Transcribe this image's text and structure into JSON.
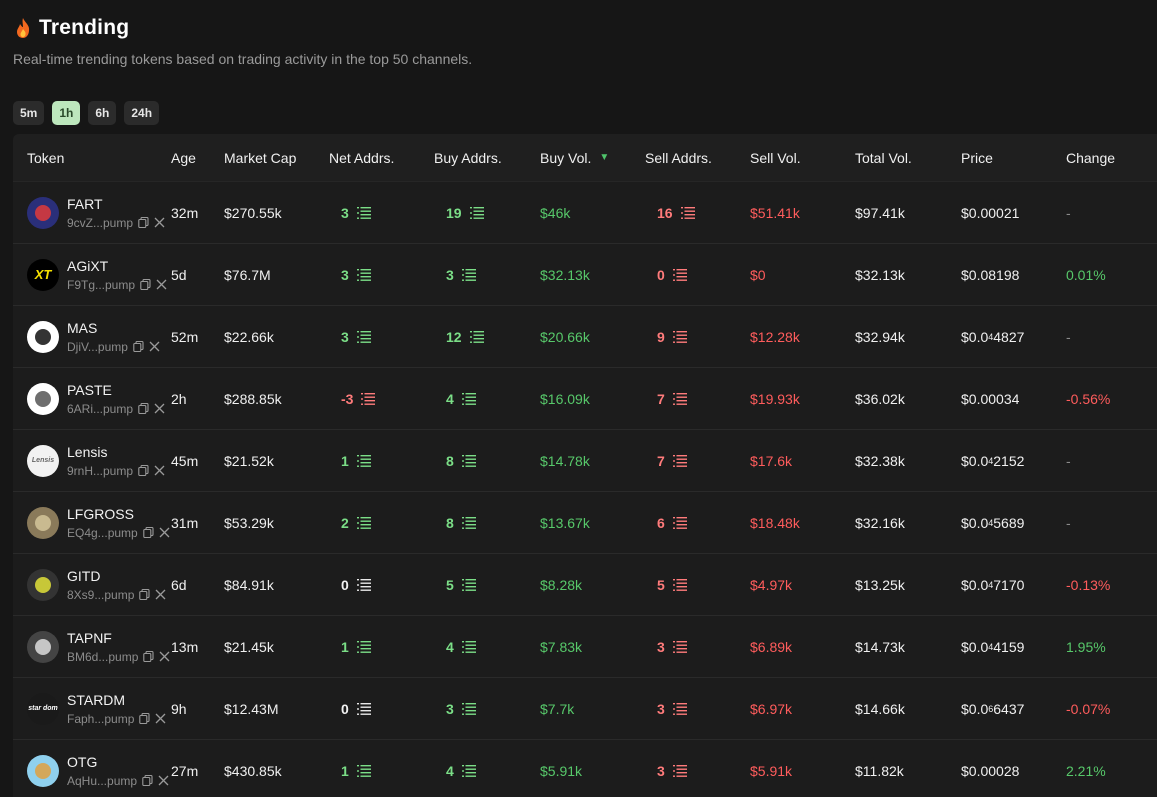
{
  "header": {
    "title": "Trending",
    "subtitle": "Real-time trending tokens based on trading activity in the top 50 channels."
  },
  "timeframes": [
    {
      "label": "5m",
      "active": false
    },
    {
      "label": "1h",
      "active": true
    },
    {
      "label": "6h",
      "active": false
    },
    {
      "label": "24h",
      "active": false
    }
  ],
  "columns": {
    "token": "Token",
    "age": "Age",
    "market_cap": "Market Cap",
    "net_addrs": "Net Addrs.",
    "buy_addrs": "Buy Addrs.",
    "buy_vol": "Buy Vol.",
    "sell_addrs": "Sell Addrs.",
    "sell_vol": "Sell Vol.",
    "total_vol": "Total Vol.",
    "price": "Price",
    "change": "Change"
  },
  "rows": [
    {
      "name": "FART",
      "addr": "9cvZ...pump",
      "age": "32m",
      "market_cap": "$270.55k",
      "net": "3",
      "net_sign": "pos",
      "buy": "19",
      "buy_vol": "$46k",
      "sell": "16",
      "sell_vol": "$51.41k",
      "total_vol": "$97.41k",
      "price_main": "$0.00021",
      "price_sub": "",
      "price_tail": "",
      "change": "-",
      "change_sign": "none"
    },
    {
      "name": "AGiXT",
      "addr": "F9Tg...pump",
      "age": "5d",
      "market_cap": "$76.7M",
      "net": "3",
      "net_sign": "pos",
      "buy": "3",
      "buy_vol": "$32.13k",
      "sell": "0",
      "sell_vol": "$0",
      "total_vol": "$32.13k",
      "price_main": "$0.08198",
      "price_sub": "",
      "price_tail": "",
      "change": "0.01%",
      "change_sign": "pos"
    },
    {
      "name": "MAS",
      "addr": "DjiV...pump",
      "age": "52m",
      "market_cap": "$22.66k",
      "net": "3",
      "net_sign": "pos",
      "buy": "12",
      "buy_vol": "$20.66k",
      "sell": "9",
      "sell_vol": "$12.28k",
      "total_vol": "$32.94k",
      "price_main": "$0.0",
      "price_sub": "4",
      "price_tail": "4827",
      "change": "-",
      "change_sign": "none"
    },
    {
      "name": "PASTE",
      "addr": "6ARi...pump",
      "age": "2h",
      "market_cap": "$288.85k",
      "net": "-3",
      "net_sign": "neg",
      "buy": "4",
      "buy_vol": "$16.09k",
      "sell": "7",
      "sell_vol": "$19.93k",
      "total_vol": "$36.02k",
      "price_main": "$0.00034",
      "price_sub": "",
      "price_tail": "",
      "change": "-0.56%",
      "change_sign": "neg"
    },
    {
      "name": "Lensis",
      "addr": "9rnH...pump",
      "age": "45m",
      "market_cap": "$21.52k",
      "net": "1",
      "net_sign": "pos",
      "buy": "8",
      "buy_vol": "$14.78k",
      "sell": "7",
      "sell_vol": "$17.6k",
      "total_vol": "$32.38k",
      "price_main": "$0.0",
      "price_sub": "4",
      "price_tail": "2152",
      "change": "-",
      "change_sign": "none"
    },
    {
      "name": "LFGROSS",
      "addr": "EQ4g...pump",
      "age": "31m",
      "market_cap": "$53.29k",
      "net": "2",
      "net_sign": "pos",
      "buy": "8",
      "buy_vol": "$13.67k",
      "sell": "6",
      "sell_vol": "$18.48k",
      "total_vol": "$32.16k",
      "price_main": "$0.0",
      "price_sub": "4",
      "price_tail": "5689",
      "change": "-",
      "change_sign": "none"
    },
    {
      "name": "GITD",
      "addr": "8Xs9...pump",
      "age": "6d",
      "market_cap": "$84.91k",
      "net": "0",
      "net_sign": "zero",
      "buy": "5",
      "buy_vol": "$8.28k",
      "sell": "5",
      "sell_vol": "$4.97k",
      "total_vol": "$13.25k",
      "price_main": "$0.0",
      "price_sub": "4",
      "price_tail": "7170",
      "change": "-0.13%",
      "change_sign": "neg"
    },
    {
      "name": "TAPNF",
      "addr": "BM6d...pump",
      "age": "13m",
      "market_cap": "$21.45k",
      "net": "1",
      "net_sign": "pos",
      "buy": "4",
      "buy_vol": "$7.83k",
      "sell": "3",
      "sell_vol": "$6.89k",
      "total_vol": "$14.73k",
      "price_main": "$0.0",
      "price_sub": "4",
      "price_tail": "4159",
      "change": "1.95%",
      "change_sign": "pos"
    },
    {
      "name": "STARDM",
      "addr": "Faph...pump",
      "age": "9h",
      "market_cap": "$12.43M",
      "net": "0",
      "net_sign": "zero",
      "buy": "3",
      "buy_vol": "$7.7k",
      "sell": "3",
      "sell_vol": "$6.97k",
      "total_vol": "$14.66k",
      "price_main": "$0.0",
      "price_sub": "6",
      "price_tail": "6437",
      "change": "-0.07%",
      "change_sign": "neg"
    },
    {
      "name": "OTG",
      "addr": "AqHu...pump",
      "age": "27m",
      "market_cap": "$430.85k",
      "net": "1",
      "net_sign": "pos",
      "buy": "4",
      "buy_vol": "$5.91k",
      "sell": "3",
      "sell_vol": "$5.91k",
      "total_vol": "$11.82k",
      "price_main": "$0.00028",
      "price_sub": "",
      "price_tail": "",
      "change": "2.21%",
      "change_sign": "pos"
    }
  ],
  "avatar_styles": [
    {
      "icon": "fart-token-icon",
      "bg": "#2a2f7a",
      "fg": "#e03a3a",
      "text": ""
    },
    {
      "icon": "agixt-token-icon",
      "bg": "#000000",
      "fg": "#f5e000",
      "text": "XT"
    },
    {
      "icon": "mas-token-icon",
      "bg": "#ffffff",
      "fg": "#111111",
      "text": ""
    },
    {
      "icon": "paste-token-icon",
      "bg": "#ffffff",
      "fg": "#555555",
      "text": ""
    },
    {
      "icon": "lensis-token-icon",
      "bg": "#f2f2f2",
      "fg": "#666666",
      "text": "Lensis"
    },
    {
      "icon": "lfgross-token-icon",
      "bg": "#8a7a5a",
      "fg": "#d4c59a",
      "text": ""
    },
    {
      "icon": "gitd-token-icon",
      "bg": "#333333",
      "fg": "#e2e23a",
      "text": ""
    },
    {
      "icon": "tapnf-token-icon",
      "bg": "#444444",
      "fg": "#dddddd",
      "text": ""
    },
    {
      "icon": "stardm-token-icon",
      "bg": "#1a1a1a",
      "fg": "#ffffff",
      "text": "star dom"
    },
    {
      "icon": "otg-token-icon",
      "bg": "#8fd0ee",
      "fg": "#e0a040",
      "text": ""
    }
  ]
}
